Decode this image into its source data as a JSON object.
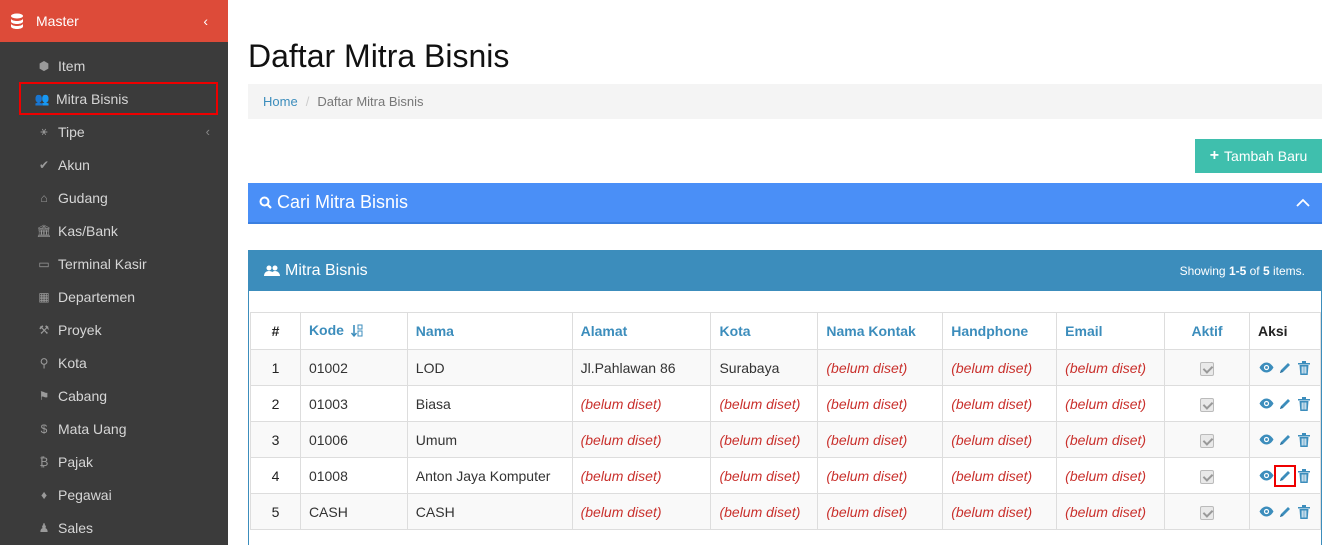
{
  "sidebar": {
    "master_label": "Master",
    "items": [
      {
        "label": "Item",
        "icon": "cube-icon",
        "glyph": "⬢"
      },
      {
        "label": "Mitra Bisnis",
        "icon": "users-icon",
        "glyph": "👥"
      },
      {
        "label": "Tipe",
        "icon": "sitemap-icon",
        "glyph": "⚹"
      },
      {
        "label": "Akun",
        "icon": "check-icon",
        "glyph": "✔"
      },
      {
        "label": "Gudang",
        "icon": "home-icon",
        "glyph": "⌂"
      },
      {
        "label": "Kas/Bank",
        "icon": "bank-icon",
        "glyph": "🏛"
      },
      {
        "label": "Terminal Kasir",
        "icon": "desktop-icon",
        "glyph": "▭"
      },
      {
        "label": "Departemen",
        "icon": "building-icon",
        "glyph": "▦"
      },
      {
        "label": "Proyek",
        "icon": "gavel-icon",
        "glyph": "⚒"
      },
      {
        "label": "Kota",
        "icon": "map-marker-icon",
        "glyph": "⚲"
      },
      {
        "label": "Cabang",
        "icon": "flag-icon",
        "glyph": "⚑"
      },
      {
        "label": "Mata Uang",
        "icon": "dollar-icon",
        "glyph": "$"
      },
      {
        "label": "Pajak",
        "icon": "bitcoin-icon",
        "glyph": "₿"
      },
      {
        "label": "Pegawai",
        "icon": "female-icon",
        "glyph": "♦"
      },
      {
        "label": "Sales",
        "icon": "male-icon",
        "glyph": "♟"
      }
    ]
  },
  "page": {
    "title": "Daftar Mitra Bisnis",
    "breadcrumb_home": "Home",
    "breadcrumb_sep": "/",
    "breadcrumb_current": "Daftar Mitra Bisnis",
    "add_button": "Tambah Baru",
    "add_button_plus": "+",
    "search_title": "Cari Mitra Bisnis"
  },
  "grid": {
    "title": "Mitra Bisnis",
    "summary_prefix": "Showing ",
    "summary_range": "1-5",
    "summary_mid": " of ",
    "summary_total": "5",
    "summary_suffix": " items.",
    "columns": [
      "#",
      "Kode",
      "Nama",
      "Alamat",
      "Kota",
      "Nama Kontak",
      "Handphone",
      "Email",
      "Aktif",
      "Aksi"
    ],
    "unset_text": "(belum diset)",
    "rows": [
      {
        "num": "1",
        "kode": "01002",
        "nama": "LOD",
        "alamat": "Jl.Pahlawan 86",
        "kota": "Surabaya",
        "kontak": "(belum diset)",
        "hp": "(belum diset)",
        "email": "(belum diset)"
      },
      {
        "num": "2",
        "kode": "01003",
        "nama": "Biasa",
        "alamat": "(belum diset)",
        "kota": "(belum diset)",
        "kontak": "(belum diset)",
        "hp": "(belum diset)",
        "email": "(belum diset)"
      },
      {
        "num": "3",
        "kode": "01006",
        "nama": "Umum",
        "alamat": "(belum diset)",
        "kota": "(belum diset)",
        "kontak": "(belum diset)",
        "hp": "(belum diset)",
        "email": "(belum diset)"
      },
      {
        "num": "4",
        "kode": "01008",
        "nama": "Anton Jaya Komputer",
        "alamat": "(belum diset)",
        "kota": "(belum diset)",
        "kontak": "(belum diset)",
        "hp": "(belum diset)",
        "email": "(belum diset)"
      },
      {
        "num": "5",
        "kode": "CASH",
        "nama": "CASH",
        "alamat": "(belum diset)",
        "kota": "(belum diset)",
        "kontak": "(belum diset)",
        "hp": "(belum diset)",
        "email": "(belum diset)"
      }
    ]
  },
  "colors": {
    "master_bg": "#dd4b39",
    "sidebar_bg": "#3b3b3b",
    "accent": "#3c8dbc",
    "search_bg": "#4a8ff7",
    "add_bg": "#3fbfad",
    "unset": "#c9302c"
  }
}
